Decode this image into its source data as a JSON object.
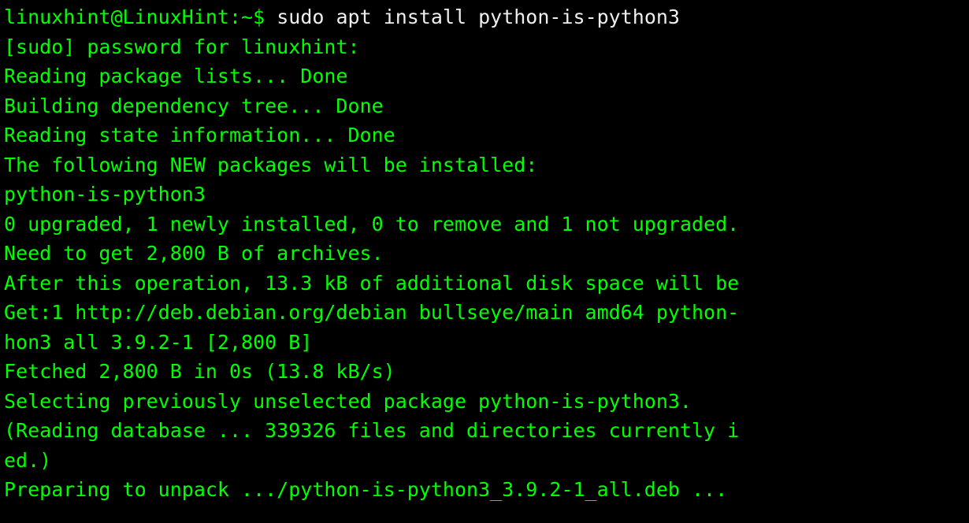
{
  "terminal": {
    "prompt": {
      "user_host": "linuxhint@LinuxHint",
      "separator": ":",
      "path": "~",
      "symbol": "$"
    },
    "command": "sudo apt install python-is-python3",
    "output_lines": [
      "[sudo] password for linuxhint:",
      "Reading package lists... Done",
      "Building dependency tree... Done",
      "Reading state information... Done",
      "The following NEW packages will be installed:",
      "  python-is-python3",
      "0 upgraded, 1 newly installed, 0 to remove and 1 not upgraded.",
      "Need to get 2,800 B of archives.",
      "After this operation, 13.3 kB of additional disk space will be",
      "Get:1 http://deb.debian.org/debian bullseye/main amd64 python-",
      "hon3 all 3.9.2-1 [2,800 B]",
      "Fetched 2,800 B in 0s (13.8 kB/s)",
      "Selecting previously unselected package python-is-python3.",
      "(Reading database ... 339326 files and directories currently i",
      "ed.)",
      "Preparing to unpack .../python-is-python3_3.9.2-1_all.deb ..."
    ]
  }
}
